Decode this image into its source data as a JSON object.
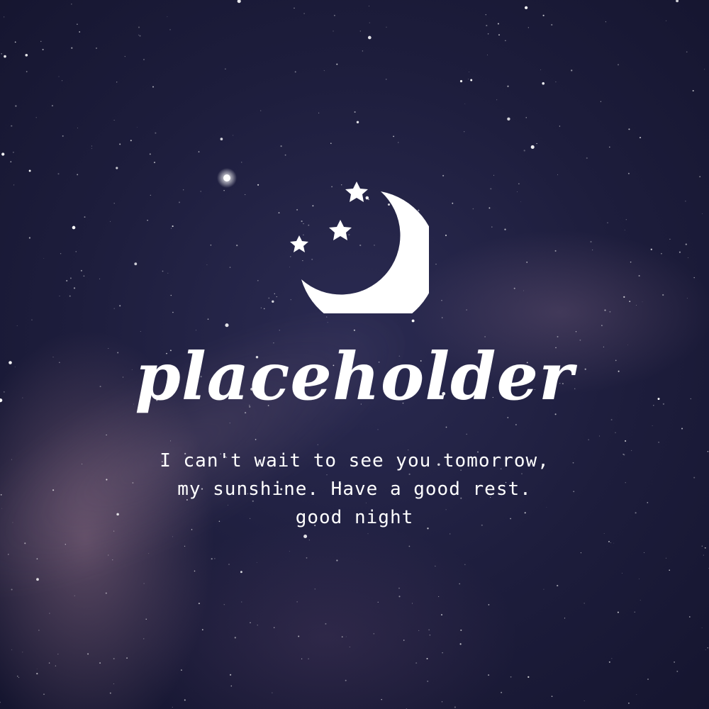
{
  "card": {
    "title": "placeholder",
    "message_lines": [
      "I can't wait to see you tomorrow,",
      "my sunshine. Have a good rest.",
      "good night"
    ],
    "icon": "moon-and-stars-icon",
    "colors": {
      "background": "#1f1f3d",
      "text": "#ffffff",
      "accent_glow": "#c6a2b6"
    }
  }
}
